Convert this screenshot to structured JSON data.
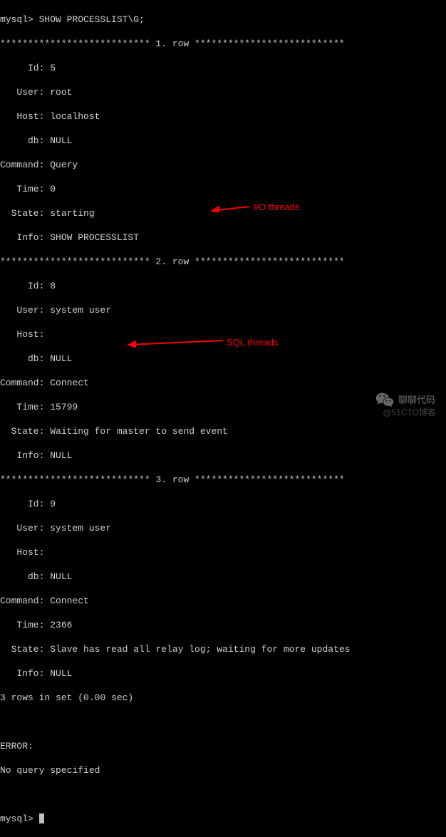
{
  "prompt1": "mysql> SHOW PROCESSLIST\\G;",
  "row1_header": "*************************** 1. row ***************************",
  "row2_header": "*************************** 2. row ***************************",
  "row3_header": "*************************** 3. row ***************************",
  "rows": [
    {
      "Id": "5",
      "User": "root",
      "Host": "localhost",
      "db": "NULL",
      "Command": "Query",
      "Time": "0",
      "State": "starting",
      "Info": "SHOW PROCESSLIST"
    },
    {
      "Id": "8",
      "User": "system user",
      "Host": "",
      "db": "NULL",
      "Command": "Connect",
      "Time": "15799",
      "State": "Waiting for master to send event",
      "Info": "NULL"
    },
    {
      "Id": "9",
      "User": "system user",
      "Host": "",
      "db": "NULL",
      "Command": "Connect",
      "Time": "2366",
      "State": "Slave has read all relay log; waiting for more updates",
      "Info": "NULL"
    }
  ],
  "summary": "3 rows in set (0.00 sec)",
  "error_label": "ERROR:",
  "error_msg": "No query specified",
  "prompt2": "mysql> ",
  "labels": {
    "id": "     Id: ",
    "user": "   User: ",
    "host": "   Host: ",
    "db": "     db: ",
    "command": "Command: ",
    "time": "   Time: ",
    "state": "  State: ",
    "info": "   Info: "
  },
  "annotations": {
    "io": "I/O threads",
    "sql": "SQL threads"
  },
  "watermark": {
    "text1": "聊聊代码",
    "text2": "@51CTO博客"
  }
}
